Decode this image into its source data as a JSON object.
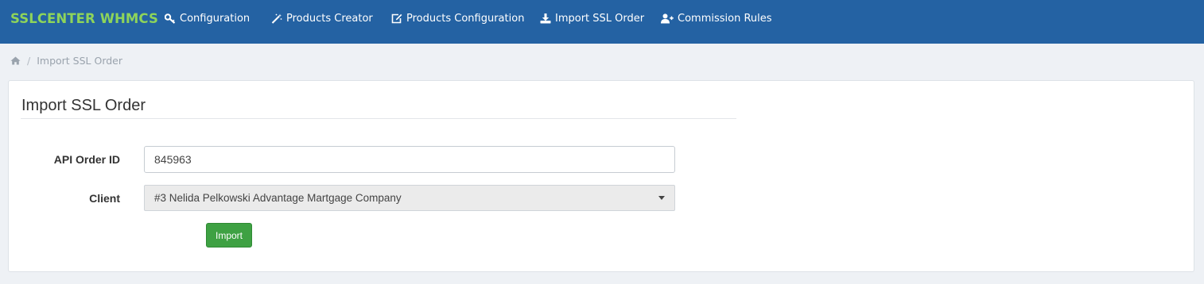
{
  "brand": {
    "title": "SSLCENTER WHMCS",
    "color": "#8ed45a"
  },
  "colors": {
    "topbar": "#2462a3",
    "page_background": "#eef1f5",
    "import_button": "#3ea143"
  },
  "nav": {
    "items": [
      {
        "label": "Configuration",
        "icon": "wrench-key-icon"
      },
      {
        "label": "Products Creator",
        "icon": "magic-wand-icon"
      },
      {
        "label": "Products Configuration",
        "icon": "edit-icon"
      },
      {
        "label": "Import SSL Order",
        "icon": "download-icon"
      },
      {
        "label": "Commission Rules",
        "icon": "user-plus-icon"
      }
    ]
  },
  "breadcrumb": {
    "home_icon": "home-icon",
    "current": "Import SSL Order"
  },
  "panel": {
    "title": "Import SSL Order"
  },
  "form": {
    "api_order_id": {
      "label": "API Order ID",
      "value": "845963"
    },
    "client": {
      "label": "Client",
      "selected": "#3 Nelida Pelkowski Advantage Martgage Company"
    },
    "import_button": "Import"
  }
}
